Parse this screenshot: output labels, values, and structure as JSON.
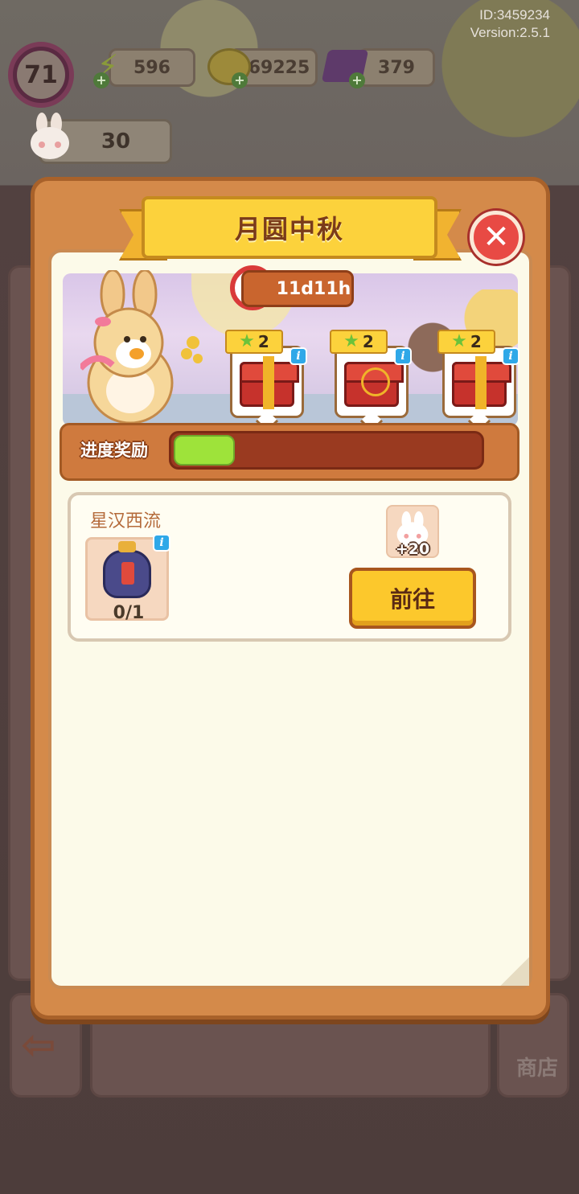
{
  "hud": {
    "id_text": "ID:3459234",
    "version_text": "Version:2.5.1",
    "level": "71",
    "energy": "596",
    "coins": "69225",
    "gems": "379",
    "bunny_count": "30"
  },
  "modal": {
    "title": "月圆中秋",
    "close_icon": "close-x",
    "timer": "11d11h",
    "progress_label": "进度奖励",
    "progress_fraction": 0.2,
    "rewards": [
      {
        "count": "2",
        "icon": "red-chest"
      },
      {
        "count": "2",
        "icon": "ornate-chest"
      },
      {
        "count": "2",
        "icon": "gift-box"
      }
    ],
    "task": {
      "title": "星汉西流",
      "progress": "0/1",
      "reward_amount": "+20",
      "go_label": "前往"
    }
  },
  "background": {
    "shop_label": "商店"
  },
  "colors": {
    "modal_frame": "#d48a4a",
    "title_banner": "#fcd23c",
    "close_button": "#e84a44",
    "progress_fill": "#9ee33a",
    "go_button": "#fcc82c",
    "info_badge": "#2fa8e8"
  }
}
